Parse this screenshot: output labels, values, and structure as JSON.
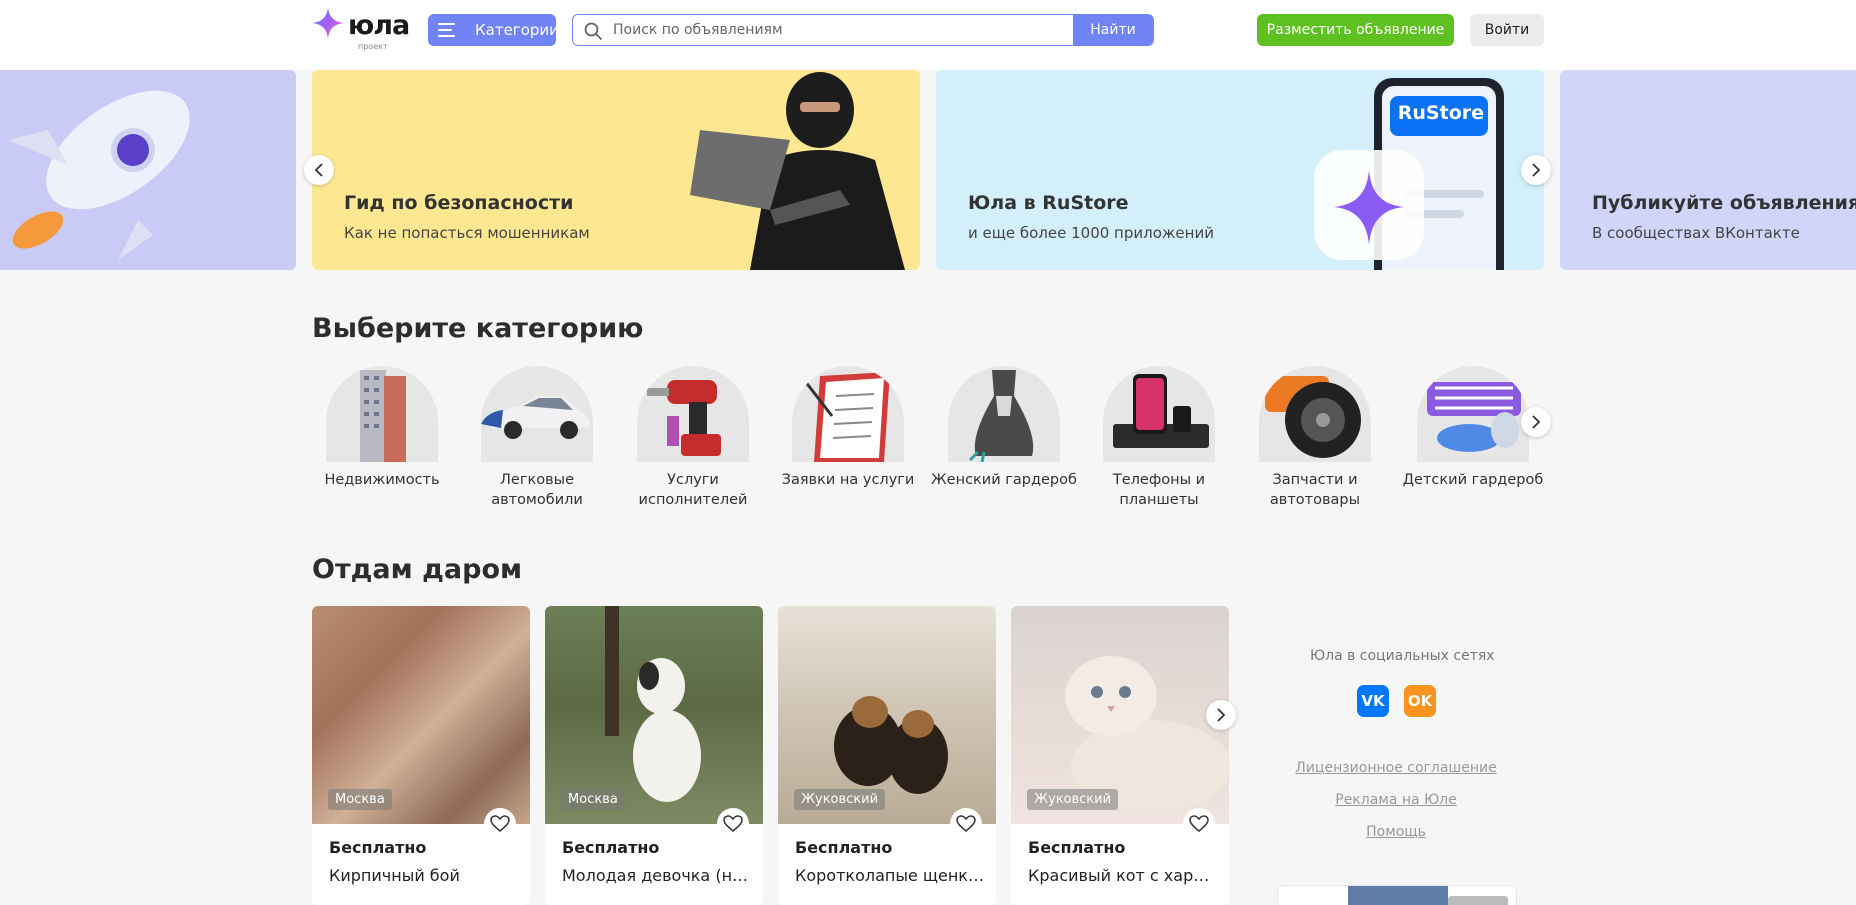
{
  "header": {
    "logo_text": "юла",
    "logo_sub": "проект",
    "categories_label": "Категории",
    "search_placeholder": "Поиск по объявлениям",
    "search_button": "Найти",
    "post_button": "Разместить объявление",
    "login_button": "Войти"
  },
  "banners": [
    {
      "title": "",
      "subtitle": ""
    },
    {
      "title": "Гид по безопасности",
      "subtitle": "Как не попасться мошенникам"
    },
    {
      "title": "Юла в RuStore",
      "subtitle": "и еще более 1000 приложений",
      "badge": "RuStore"
    },
    {
      "title": "Публикуйте объявления",
      "subtitle": "В сообществах ВКонтакте"
    }
  ],
  "categories_section": {
    "title": "Выберите категорию",
    "items": [
      {
        "label": "Недвижимость"
      },
      {
        "label": "Легковые автомобили"
      },
      {
        "label": "Услуги исполнителей"
      },
      {
        "label": "Заявки на услуги"
      },
      {
        "label": "Женский гардероб"
      },
      {
        "label": "Телефоны и планшеты"
      },
      {
        "label": "Запчасти и автотовары"
      },
      {
        "label": "Детский гардероб"
      }
    ]
  },
  "free_section": {
    "title": "Отдам даром",
    "cards": [
      {
        "city": "Москва",
        "price": "Бесплатно",
        "title": "Кирпичный бой"
      },
      {
        "city": "Москва",
        "price": "Бесплатно",
        "title": "Молодая девочка (не …"
      },
      {
        "city": "Жуковский",
        "price": "Бесплатно",
        "title": "Коротколапые щенки…"
      },
      {
        "city": "Жуковский",
        "price": "Бесплатно",
        "title": "Красивый кот с харр…"
      }
    ]
  },
  "sidebar": {
    "social_title": "Юла в социальных сетях",
    "vk_label": "VK",
    "ok_label": "OK",
    "links": [
      "Лицензионное соглашение",
      "Реклама на Юле",
      "Помощь"
    ]
  },
  "colors": {
    "accent": "#7184f5",
    "post_green": "#5ec121",
    "vk_blue": "#0077ff",
    "ok_orange": "#f7931e"
  }
}
